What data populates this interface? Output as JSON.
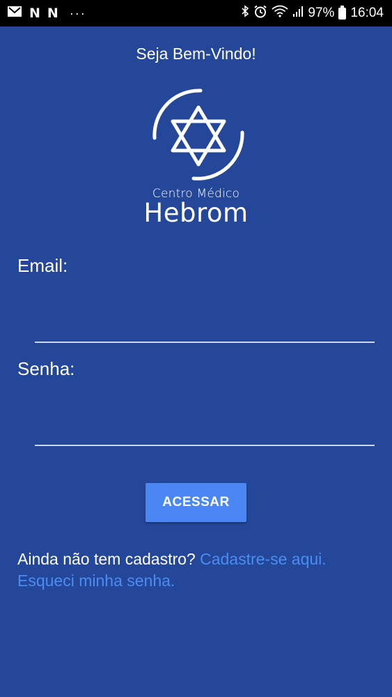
{
  "status_bar": {
    "time": "16:04",
    "battery": "97%",
    "icons": [
      "gmail-icon",
      "n-icon",
      "n-icon",
      "more-dots-icon",
      "bluetooth-icon",
      "alarm-icon",
      "wifi-icon",
      "signal-icon",
      "battery-icon"
    ],
    "n_glyph": "N",
    "dots": "···"
  },
  "header": {
    "welcome": "Seja Bem-Vindo!"
  },
  "logo": {
    "subtitle": "Centro Médico",
    "name": "Hebrom"
  },
  "form": {
    "email_label": "Email:",
    "email_value": "",
    "password_label": "Senha:",
    "password_value": "",
    "submit_label": "ACESSAR"
  },
  "footer": {
    "register_prompt": "Ainda não tem cadastro?",
    "register_link": "Cadastre-se aqui.",
    "forgot_link": "Esqueci minha senha."
  },
  "colors": {
    "background": "#25479a",
    "button": "#4a87f3",
    "link": "#4a8df2",
    "status_bar": "#000000"
  }
}
